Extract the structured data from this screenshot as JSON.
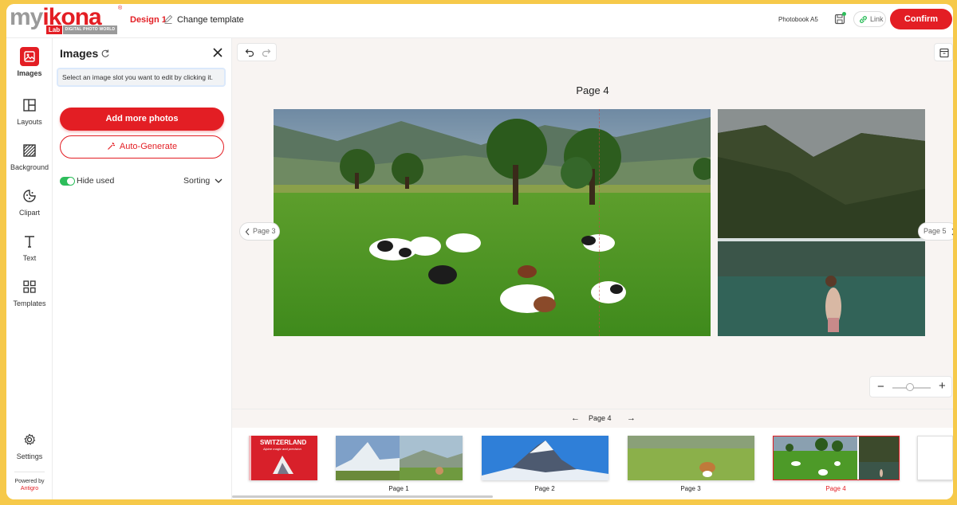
{
  "header": {
    "logo": {
      "word1": "my",
      "word2": "ikona",
      "lab": "Lab",
      "tagline": "DIGITAL PHOTO WORLD",
      "reg": "®"
    },
    "design_name": "Design 1",
    "change_template": "Change template",
    "product": "Photobook A5",
    "link_label": "Link",
    "confirm_label": "Confirm"
  },
  "rail": {
    "items": [
      {
        "label": "Images",
        "icon": "image-icon",
        "active": true
      },
      {
        "label": "Layouts",
        "icon": "layout-icon"
      },
      {
        "label": "Background",
        "icon": "background-icon"
      },
      {
        "label": "Clipart",
        "icon": "clipart-icon"
      },
      {
        "label": "Text",
        "icon": "text-icon"
      },
      {
        "label": "Templates",
        "icon": "templates-icon"
      }
    ],
    "settings_label": "Settings",
    "powered_by": "Powered by",
    "powered_brand": "Antigro"
  },
  "panel": {
    "title": "Images",
    "hint": "Select an image slot you want to edit by clicking it.",
    "add_photos": "Add more photos",
    "auto_generate": "Auto-Generate",
    "hide_used": "Hide used",
    "hide_used_on": true,
    "sorting": "Sorting"
  },
  "canvas": {
    "page_title": "Page 4",
    "prev_page": "Page 3",
    "next_page": "Page 5"
  },
  "pagebar": {
    "current": "Page 4"
  },
  "thumbnails": [
    {
      "label": "",
      "cover_title": "SWITZERLAND",
      "cover_subtitle": "Alpine magic and precision"
    },
    {
      "label": "Page 1"
    },
    {
      "label": "Page 2"
    },
    {
      "label": "Page 3"
    },
    {
      "label": "Page 4",
      "active": true
    }
  ],
  "colors": {
    "accent": "#e31e24",
    "toggle": "#2dbd5b"
  }
}
